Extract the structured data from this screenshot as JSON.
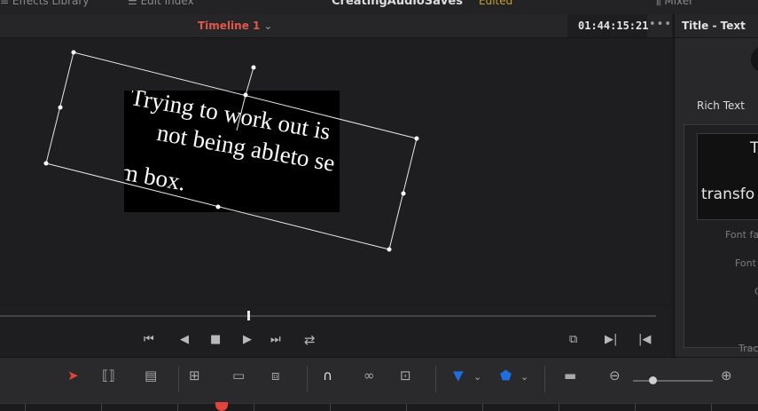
{
  "topbar": {
    "effects_library": "Effects Library",
    "edit_index": "Edit Index",
    "project_name": "CreatingAudioSaves",
    "edited_status": "Edited",
    "mixer": "Mixer"
  },
  "viewer": {
    "timeline_name": "Timeline 1",
    "timecode": "01:44:15:21",
    "dots": "•••",
    "title_lines": [
      "Trying to work out is",
      "not being ableto se",
      "m box."
    ]
  },
  "inspector": {
    "title": "Title - Text",
    "rich_text_label": "Rich Text",
    "text_line1": "T",
    "text_line2": "transfo",
    "labels": [
      "Font fa",
      "Font",
      "C",
      "Trac"
    ]
  },
  "colors": {
    "timeline_name": "#e0574b",
    "edited": "#c9a227",
    "select_tool": "#e0443a",
    "flag_blue": "#1f6fe0"
  },
  "icons": {
    "effects": "effects-library-icon",
    "edit_index": "edit-index-icon",
    "go_start": "go-to-start-icon",
    "play_reverse": "play-reverse-icon",
    "stop": "stop-icon",
    "play": "play-icon",
    "go_end": "go-to-end-icon",
    "loop": "loop-icon",
    "select": "selection-tool-icon",
    "snap": "snapping-magnet-icon",
    "link": "link-icon",
    "lock": "position-lock-icon",
    "flag": "flag-icon",
    "marker": "marker-icon",
    "zoom_out": "zoom-out-icon",
    "zoom_in": "zoom-in-icon"
  }
}
